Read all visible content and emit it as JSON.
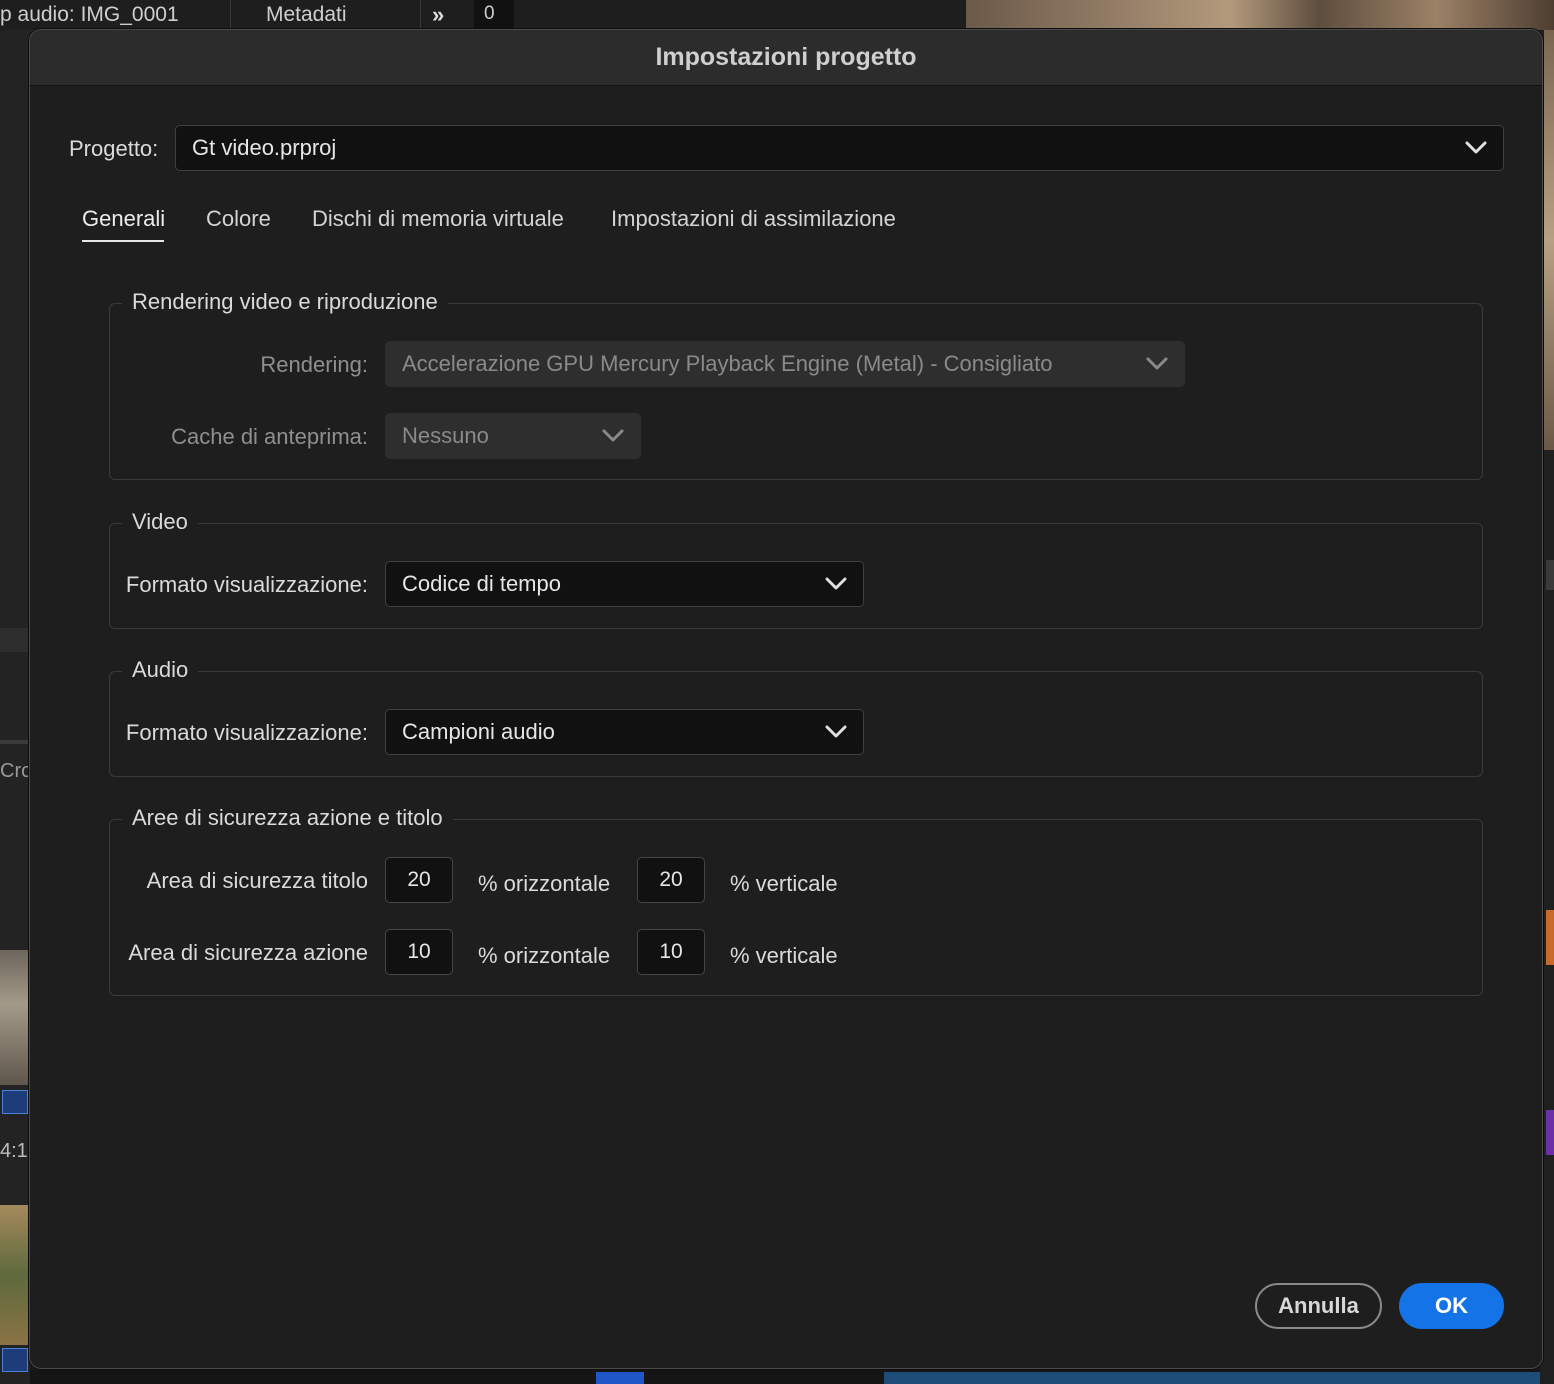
{
  "background": {
    "panel_tab_audio": "p audio: IMG_0001",
    "panel_tab_metadata": "Metadati",
    "overflow_glyph": "»",
    "timecode_field": "0",
    "left_label_fragment": "Cro",
    "left_time_fragment": "4:1"
  },
  "dialog": {
    "title": "Impostazioni progetto",
    "project": {
      "label": "Progetto:",
      "value": "Gt video.prproj"
    },
    "tabs": [
      {
        "label": "Generali",
        "active": true
      },
      {
        "label": "Colore",
        "active": false
      },
      {
        "label": "Dischi di memoria virtuale",
        "active": false
      },
      {
        "label": "Impostazioni di assimilazione",
        "active": false
      }
    ],
    "rendering_group": {
      "title": "Rendering video e riproduzione",
      "rendering_label": "Rendering:",
      "rendering_value": "Accelerazione GPU Mercury Playback Engine (Metal) - Consigliato",
      "cache_label": "Cache di anteprima:",
      "cache_value": "Nessuno"
    },
    "video_group": {
      "title": "Video",
      "format_label": "Formato visualizzazione:",
      "format_value": "Codice di tempo"
    },
    "audio_group": {
      "title": "Audio",
      "format_label": "Formato visualizzazione:",
      "format_value": "Campioni audio"
    },
    "safe_areas_group": {
      "title": "Aree di sicurezza azione e titolo",
      "title_safe": {
        "label": "Area di sicurezza titolo",
        "horizontal": "20",
        "horizontal_unit": "% orizzontale",
        "vertical": "20",
        "vertical_unit": "% verticale"
      },
      "action_safe": {
        "label": "Area di sicurezza azione",
        "horizontal": "10",
        "horizontal_unit": "% orizzontale",
        "vertical": "10",
        "vertical_unit": "% verticale"
      }
    },
    "buttons": {
      "cancel": "Annulla",
      "ok": "OK"
    }
  },
  "colors": {
    "accent": "#1473e6",
    "dialog_bg": "#1e1e1e",
    "titlebar_bg": "#2c2c2c",
    "field_bg": "#111111"
  },
  "icons": {
    "dropdown": "chevron-down-icon",
    "overflow": "double-chevron-right-icon"
  }
}
